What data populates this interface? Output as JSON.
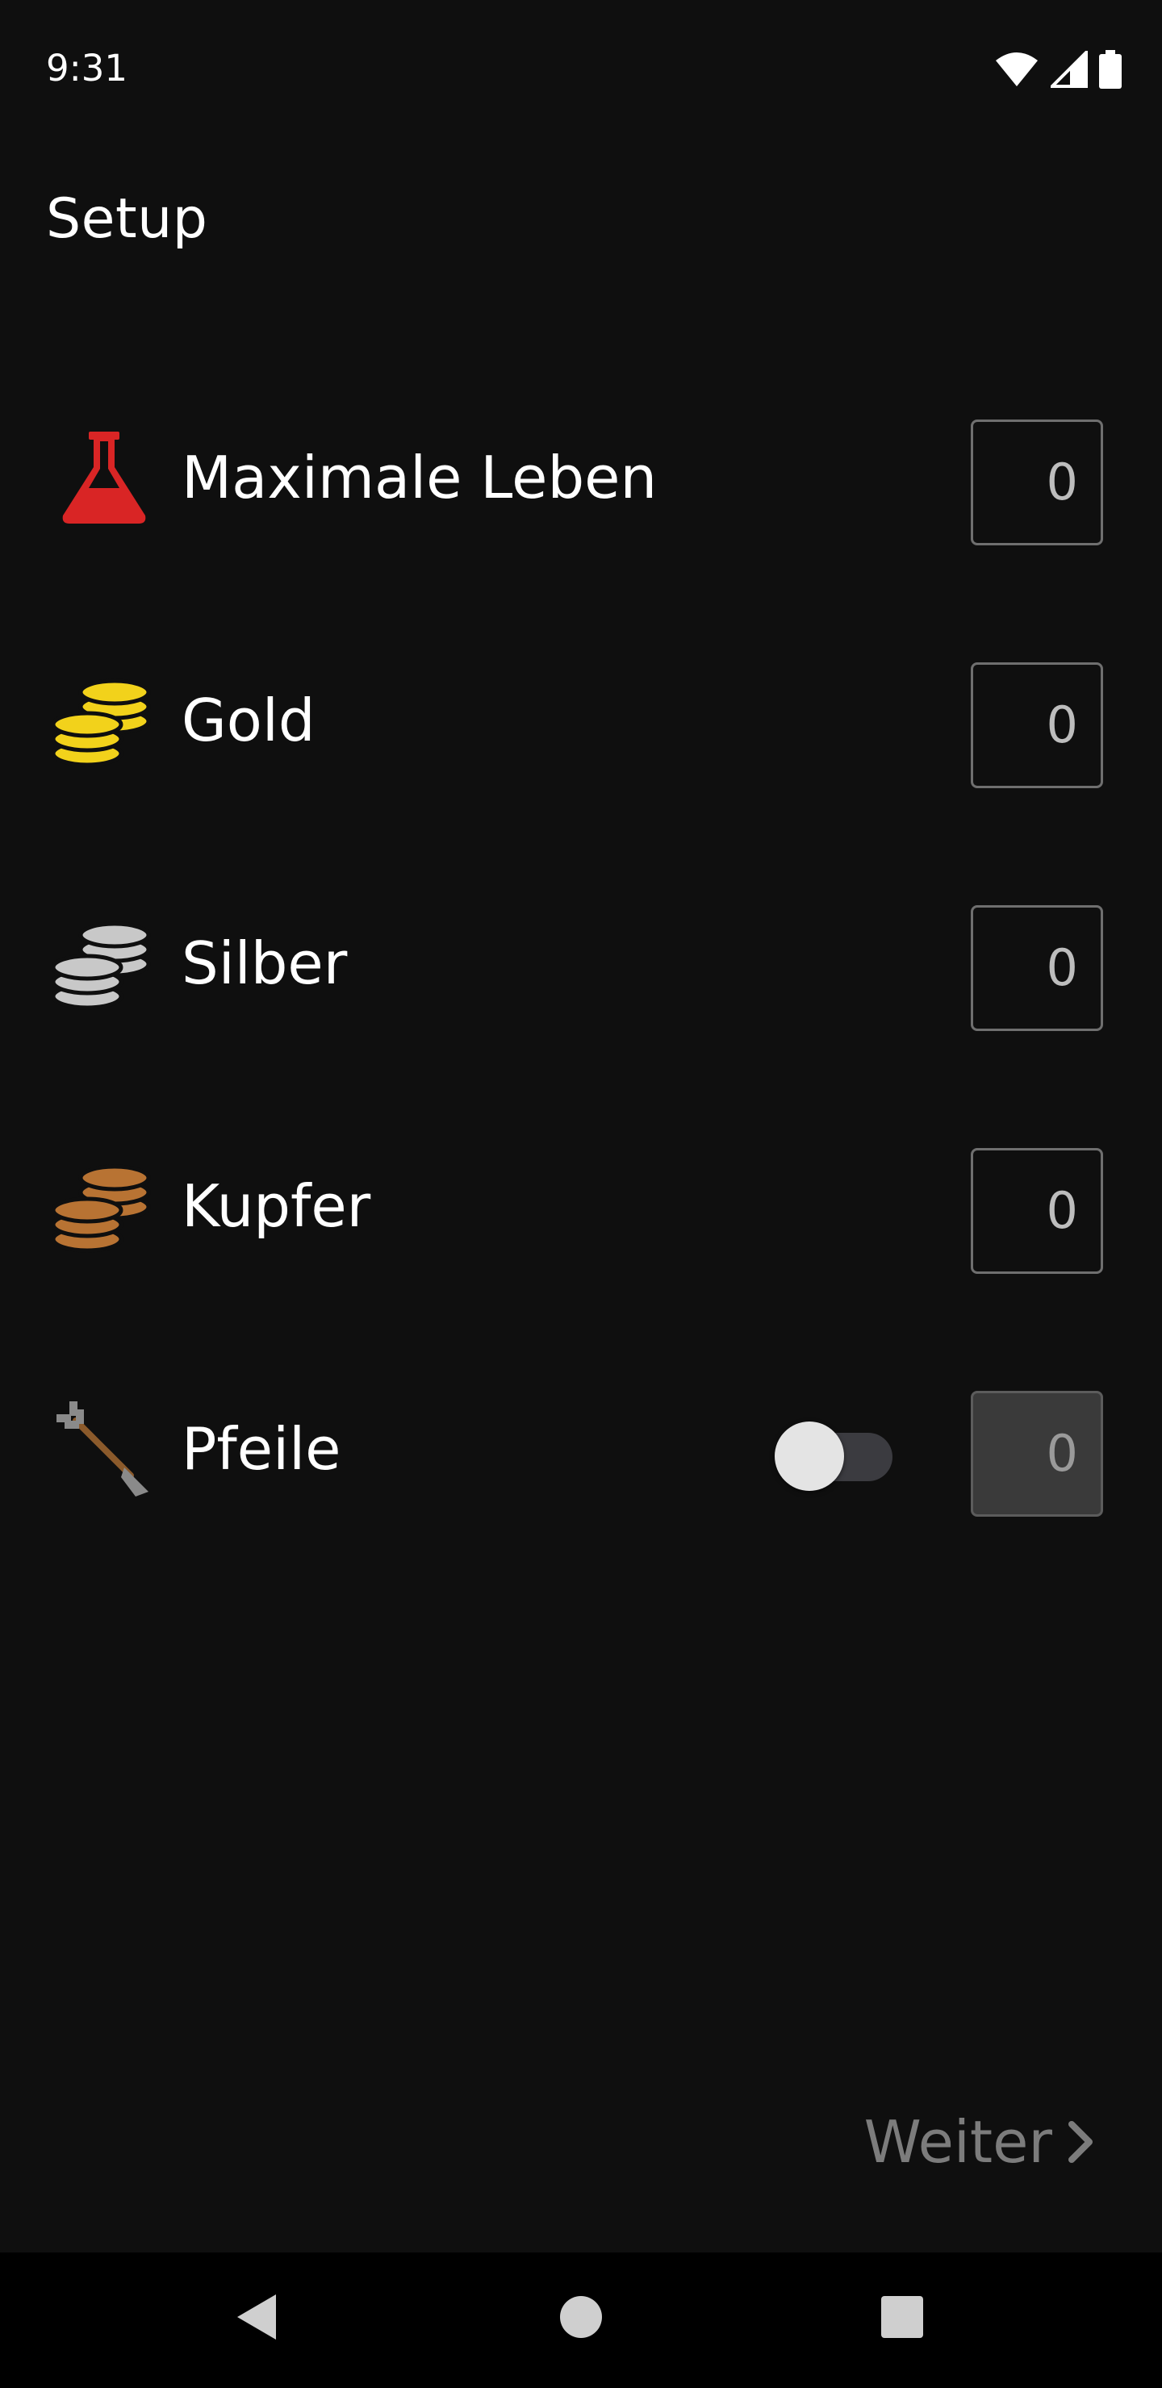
{
  "status_bar": {
    "time": "9:31",
    "icons": [
      "wifi-icon",
      "signal-icon",
      "battery-icon"
    ]
  },
  "header": {
    "title": "Setup"
  },
  "rows": [
    {
      "label": "Maximale Leben",
      "icon": "potion-flask-icon",
      "value": "0",
      "color": "#d92525"
    },
    {
      "label": "Gold",
      "icon": "gold-coins-icon",
      "value": "0",
      "color": "#f2d21b"
    },
    {
      "label": "Silber",
      "icon": "silver-coins-icon",
      "value": "0",
      "color": "#c8c8c8"
    },
    {
      "label": "Kupfer",
      "icon": "copper-coins-icon",
      "value": "0",
      "color": "#b87333"
    },
    {
      "label": "Pfeile",
      "icon": "arrow-icon",
      "value": "0",
      "toggle_on": false,
      "field_enabled": false
    }
  ],
  "footer": {
    "next_label": "Weiter",
    "next_enabled": false
  },
  "nav": {
    "buttons": [
      "back-icon",
      "home-icon",
      "recents-icon"
    ]
  }
}
